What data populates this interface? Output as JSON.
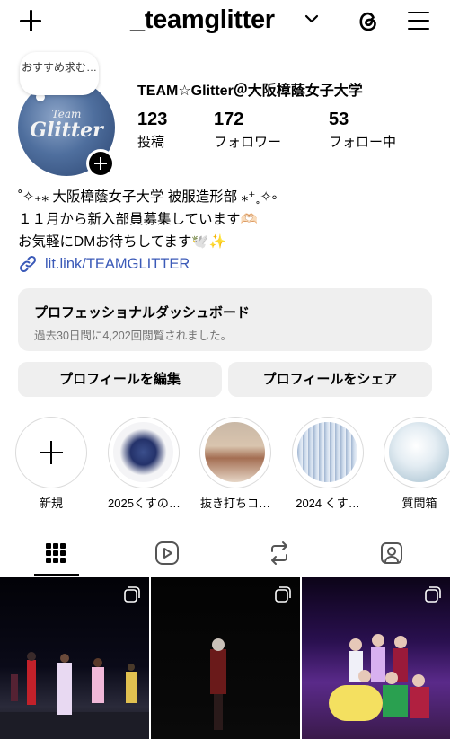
{
  "header": {
    "username": "_teamglitter"
  },
  "profile": {
    "note": "おすすめ求む…",
    "avatar_text_small": "Team",
    "avatar_text_large": "Glitter",
    "display_name": "TEAM☆Glitter＠大阪樟蔭女子大学",
    "stats": [
      {
        "value": "123",
        "label": "投稿"
      },
      {
        "value": "172",
        "label": "フォロワー"
      },
      {
        "value": "53",
        "label": "フォロー中"
      }
    ],
    "bio_lines": [
      "˚✧₊⁎ 大阪樟蔭女子大学 被服造形部 ⁎⁺˳✧༚",
      "１１月から新入部員募集しています🫶🏻",
      "お気軽にDMお待ちしてます🕊️✨"
    ],
    "link": "lit.link/TEAMGLITTER"
  },
  "dashboard": {
    "title": "プロフェッショナルダッシュボード",
    "subtitle": "過去30日間に4,202回閲覧されました。"
  },
  "buttons": {
    "edit": "プロフィールを編集",
    "share": "プロフィールをシェア"
  },
  "highlights": [
    {
      "label": "新規"
    },
    {
      "label": "2025くすの…"
    },
    {
      "label": "抜き打ちコ…"
    },
    {
      "label": "2024 くす…"
    },
    {
      "label": "質問箱"
    }
  ],
  "colors": {
    "link": "#3b5ab8",
    "button_bg": "#efefef",
    "secondary_text": "#737373"
  }
}
